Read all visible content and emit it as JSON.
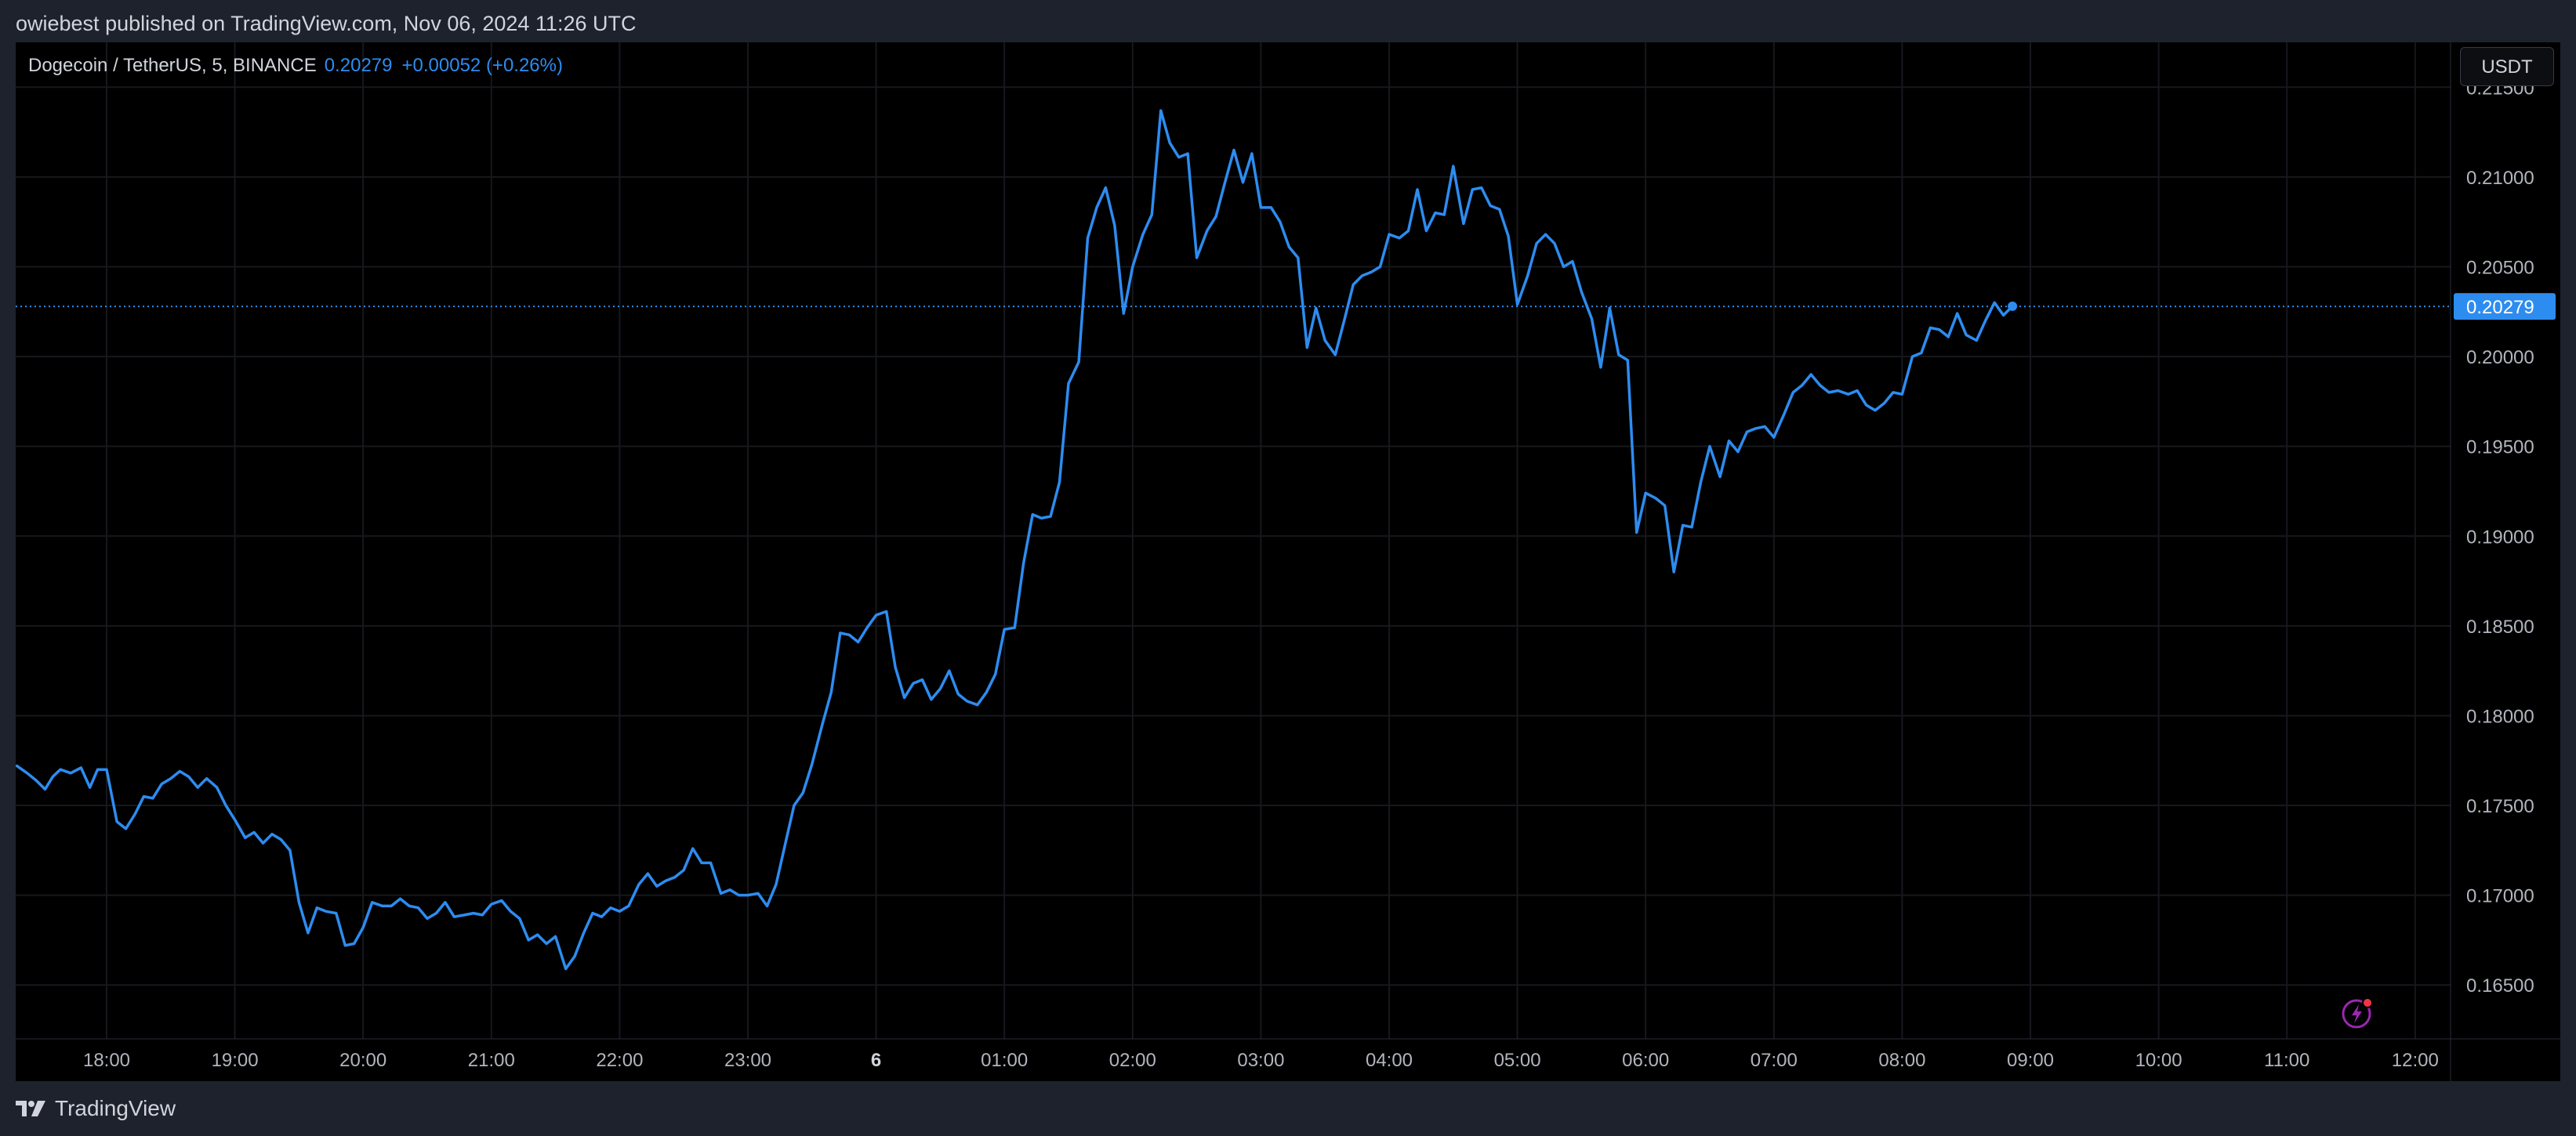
{
  "header": {
    "publisher_line": "owiebest published on TradingView.com, Nov 06, 2024 11:26 UTC"
  },
  "legend": {
    "symbol": "Dogecoin / TetherUS, 5, BINANCE",
    "last_value": "0.20279",
    "change": "+0.00052 (+0.26%)"
  },
  "currency_button": "USDT",
  "footer": {
    "brand": "TradingView"
  },
  "colors": {
    "line": "#2d8cf0",
    "background": "#000000",
    "frame": "#1e222d",
    "grid": "#16181d",
    "axis_text": "#b2b5be"
  },
  "icons": {
    "lightning": "lightning-icon",
    "logo": "tradingview-logo-icon"
  },
  "chart_data": {
    "type": "line",
    "title": "Dogecoin / TetherUS, 5, BINANCE",
    "xlabel": "",
    "ylabel": "",
    "ylim": [
      0.162,
      0.2175
    ],
    "grid": true,
    "last_price": 0.20279,
    "y_ticks": [
      "0.21500",
      "0.21000",
      "0.20500",
      "0.20000",
      "0.19500",
      "0.19000",
      "0.18500",
      "0.18000",
      "0.17500",
      "0.17000",
      "0.16500"
    ],
    "x_ticks": [
      {
        "label": "18:00",
        "t": 0.0
      },
      {
        "label": "19:00",
        "t": 1.0
      },
      {
        "label": "20:00",
        "t": 2.0
      },
      {
        "label": "21:00",
        "t": 3.0
      },
      {
        "label": "22:00",
        "t": 4.0
      },
      {
        "label": "23:00",
        "t": 5.0
      },
      {
        "label": "6",
        "t": 6.0,
        "bold": true
      },
      {
        "label": "01:00",
        "t": 7.0
      },
      {
        "label": "02:00",
        "t": 8.0
      },
      {
        "label": "03:00",
        "t": 9.0
      },
      {
        "label": "04:00",
        "t": 10.0
      },
      {
        "label": "05:00",
        "t": 11.0
      },
      {
        "label": "06:00",
        "t": 12.0
      },
      {
        "label": "07:00",
        "t": 13.0
      },
      {
        "label": "08:00",
        "t": 14.0
      },
      {
        "label": "09:00",
        "t": 15.0
      },
      {
        "label": "10:00",
        "t": 16.0
      },
      {
        "label": "11:00",
        "t": 17.0
      },
      {
        "label": "12:00",
        "t": 18.0
      }
    ],
    "series": [
      {
        "points": [
          [
            -0.7,
            0.1772
          ],
          [
            -0.62,
            0.1768
          ],
          [
            -0.55,
            0.1764
          ],
          [
            -0.48,
            0.1759
          ],
          [
            -0.42,
            0.1766
          ],
          [
            -0.36,
            0.177
          ],
          [
            -0.28,
            0.1768
          ],
          [
            -0.2,
            0.1771
          ],
          [
            -0.13,
            0.176
          ],
          [
            -0.07,
            0.177
          ],
          [
            0.0,
            0.177
          ],
          [
            0.08,
            0.1741
          ],
          [
            0.15,
            0.1737
          ],
          [
            0.22,
            0.1745
          ],
          [
            0.29,
            0.1755
          ],
          [
            0.36,
            0.1754
          ],
          [
            0.43,
            0.1762
          ],
          [
            0.5,
            0.1765
          ],
          [
            0.57,
            0.1769
          ],
          [
            0.64,
            0.1766
          ],
          [
            0.71,
            0.176
          ],
          [
            0.78,
            0.1765
          ],
          [
            0.86,
            0.176
          ],
          [
            0.93,
            0.175
          ],
          [
            1.0,
            0.1742
          ],
          [
            1.08,
            0.1732
          ],
          [
            1.15,
            0.1735
          ],
          [
            1.22,
            0.1729
          ],
          [
            1.29,
            0.1734
          ],
          [
            1.36,
            0.1731
          ],
          [
            1.43,
            0.1725
          ],
          [
            1.5,
            0.1696
          ],
          [
            1.57,
            0.1679
          ],
          [
            1.64,
            0.1693
          ],
          [
            1.71,
            0.1691
          ],
          [
            1.79,
            0.169
          ],
          [
            1.86,
            0.1672
          ],
          [
            1.93,
            0.1673
          ],
          [
            2.0,
            0.1682
          ],
          [
            2.07,
            0.1696
          ],
          [
            2.15,
            0.1694
          ],
          [
            2.22,
            0.1694
          ],
          [
            2.29,
            0.1698
          ],
          [
            2.36,
            0.1694
          ],
          [
            2.43,
            0.1693
          ],
          [
            2.5,
            0.1687
          ],
          [
            2.57,
            0.169
          ],
          [
            2.64,
            0.1696
          ],
          [
            2.71,
            0.1688
          ],
          [
            2.79,
            0.1689
          ],
          [
            2.86,
            0.169
          ],
          [
            2.93,
            0.1689
          ],
          [
            3.0,
            0.1695
          ],
          [
            3.08,
            0.1697
          ],
          [
            3.15,
            0.1691
          ],
          [
            3.22,
            0.1687
          ],
          [
            3.29,
            0.1675
          ],
          [
            3.36,
            0.1678
          ],
          [
            3.43,
            0.1673
          ],
          [
            3.5,
            0.1677
          ],
          [
            3.58,
            0.1659
          ],
          [
            3.65,
            0.1666
          ],
          [
            3.72,
            0.1679
          ],
          [
            3.79,
            0.169
          ],
          [
            3.86,
            0.1688
          ],
          [
            3.93,
            0.1693
          ],
          [
            4.0,
            0.1691
          ],
          [
            4.07,
            0.1694
          ],
          [
            4.15,
            0.1706
          ],
          [
            4.22,
            0.1712
          ],
          [
            4.29,
            0.1705
          ],
          [
            4.36,
            0.1708
          ],
          [
            4.43,
            0.171
          ],
          [
            4.5,
            0.1714
          ],
          [
            4.57,
            0.1726
          ],
          [
            4.64,
            0.1718
          ],
          [
            4.71,
            0.1718
          ],
          [
            4.79,
            0.1701
          ],
          [
            4.86,
            0.1703
          ],
          [
            4.93,
            0.17
          ],
          [
            5.0,
            0.17
          ],
          [
            5.08,
            0.1701
          ],
          [
            5.15,
            0.1694
          ],
          [
            5.22,
            0.1706
          ],
          [
            5.29,
            0.1728
          ],
          [
            5.36,
            0.175
          ],
          [
            5.43,
            0.1757
          ],
          [
            5.5,
            0.1773
          ],
          [
            5.58,
            0.1795
          ],
          [
            5.65,
            0.1813
          ],
          [
            5.72,
            0.1846
          ],
          [
            5.79,
            0.1845
          ],
          [
            5.86,
            0.1841
          ],
          [
            5.93,
            0.1849
          ],
          [
            6.0,
            0.1856
          ],
          [
            6.08,
            0.1858
          ],
          [
            6.15,
            0.1827
          ],
          [
            6.22,
            0.181
          ],
          [
            6.29,
            0.1818
          ],
          [
            6.36,
            0.182
          ],
          [
            6.43,
            0.1809
          ],
          [
            6.5,
            0.1815
          ],
          [
            6.57,
            0.1825
          ],
          [
            6.64,
            0.1812
          ],
          [
            6.71,
            0.1808
          ],
          [
            6.79,
            0.1806
          ],
          [
            6.86,
            0.1813
          ],
          [
            6.93,
            0.1823
          ],
          [
            7.0,
            0.1848
          ],
          [
            7.08,
            0.1849
          ],
          [
            7.15,
            0.1885
          ],
          [
            7.22,
            0.1912
          ],
          [
            7.29,
            0.191
          ],
          [
            7.36,
            0.1911
          ],
          [
            7.43,
            0.193
          ],
          [
            7.5,
            0.1985
          ],
          [
            7.58,
            0.1997
          ],
          [
            7.65,
            0.2066
          ],
          [
            7.72,
            0.2083
          ],
          [
            7.79,
            0.2094
          ],
          [
            7.86,
            0.2073
          ],
          [
            7.93,
            0.2024
          ],
          [
            8.0,
            0.205
          ],
          [
            8.08,
            0.2068
          ],
          [
            8.15,
            0.2079
          ],
          [
            8.22,
            0.2137
          ],
          [
            8.29,
            0.2119
          ],
          [
            8.36,
            0.2111
          ],
          [
            8.43,
            0.2113
          ],
          [
            8.5,
            0.2055
          ],
          [
            8.58,
            0.207
          ],
          [
            8.65,
            0.2078
          ],
          [
            8.72,
            0.2097
          ],
          [
            8.79,
            0.2115
          ],
          [
            8.86,
            0.2097
          ],
          [
            8.93,
            0.2113
          ],
          [
            9.0,
            0.2083
          ],
          [
            9.08,
            0.2083
          ],
          [
            9.15,
            0.2075
          ],
          [
            9.22,
            0.2061
          ],
          [
            9.29,
            0.2055
          ],
          [
            9.36,
            0.2005
          ],
          [
            9.43,
            0.2027
          ],
          [
            9.5,
            0.2009
          ],
          [
            9.58,
            0.2001
          ],
          [
            9.65,
            0.202
          ],
          [
            9.72,
            0.204
          ],
          [
            9.79,
            0.2045
          ],
          [
            9.86,
            0.2047
          ],
          [
            9.93,
            0.205
          ],
          [
            10.0,
            0.2068
          ],
          [
            10.08,
            0.2066
          ],
          [
            10.15,
            0.207
          ],
          [
            10.22,
            0.2093
          ],
          [
            10.29,
            0.207
          ],
          [
            10.36,
            0.208
          ],
          [
            10.43,
            0.2079
          ],
          [
            10.5,
            0.2106
          ],
          [
            10.58,
            0.2074
          ],
          [
            10.65,
            0.2093
          ],
          [
            10.72,
            0.2094
          ],
          [
            10.79,
            0.2084
          ],
          [
            10.86,
            0.2082
          ],
          [
            10.93,
            0.2067
          ],
          [
            11.0,
            0.2029
          ],
          [
            11.08,
            0.2045
          ],
          [
            11.15,
            0.2063
          ],
          [
            11.22,
            0.2068
          ],
          [
            11.29,
            0.2063
          ],
          [
            11.36,
            0.205
          ],
          [
            11.43,
            0.2053
          ],
          [
            11.5,
            0.2036
          ],
          [
            11.58,
            0.2021
          ],
          [
            11.65,
            0.1994
          ],
          [
            11.72,
            0.2027
          ],
          [
            11.79,
            0.2001
          ],
          [
            11.86,
            0.1998
          ],
          [
            11.93,
            0.1902
          ],
          [
            12.0,
            0.1924
          ],
          [
            12.08,
            0.1921
          ],
          [
            12.15,
            0.1917
          ],
          [
            12.22,
            0.188
          ],
          [
            12.29,
            0.1906
          ],
          [
            12.36,
            0.1905
          ],
          [
            12.43,
            0.193
          ],
          [
            12.5,
            0.195
          ],
          [
            12.58,
            0.1933
          ],
          [
            12.65,
            0.1953
          ],
          [
            12.72,
            0.1947
          ],
          [
            12.79,
            0.1958
          ],
          [
            12.86,
            0.196
          ],
          [
            12.93,
            0.1961
          ],
          [
            13.0,
            0.1955
          ],
          [
            13.08,
            0.1968
          ],
          [
            13.15,
            0.198
          ],
          [
            13.22,
            0.1984
          ],
          [
            13.29,
            0.199
          ],
          [
            13.36,
            0.1984
          ],
          [
            13.43,
            0.198
          ],
          [
            13.5,
            0.1981
          ],
          [
            13.58,
            0.1979
          ],
          [
            13.65,
            0.1981
          ],
          [
            13.72,
            0.1973
          ],
          [
            13.79,
            0.197
          ],
          [
            13.86,
            0.1974
          ],
          [
            13.93,
            0.198
          ],
          [
            14.0,
            0.1979
          ],
          [
            14.08,
            0.2
          ],
          [
            14.15,
            0.2002
          ],
          [
            14.22,
            0.2016
          ],
          [
            14.29,
            0.2015
          ],
          [
            14.36,
            0.2011
          ],
          [
            14.43,
            0.2024
          ],
          [
            14.5,
            0.2012
          ],
          [
            14.58,
            0.2009
          ],
          [
            14.65,
            0.202
          ],
          [
            14.72,
            0.203
          ],
          [
            14.79,
            0.2023
          ],
          [
            14.86,
            0.2028
          ]
        ]
      }
    ]
  }
}
